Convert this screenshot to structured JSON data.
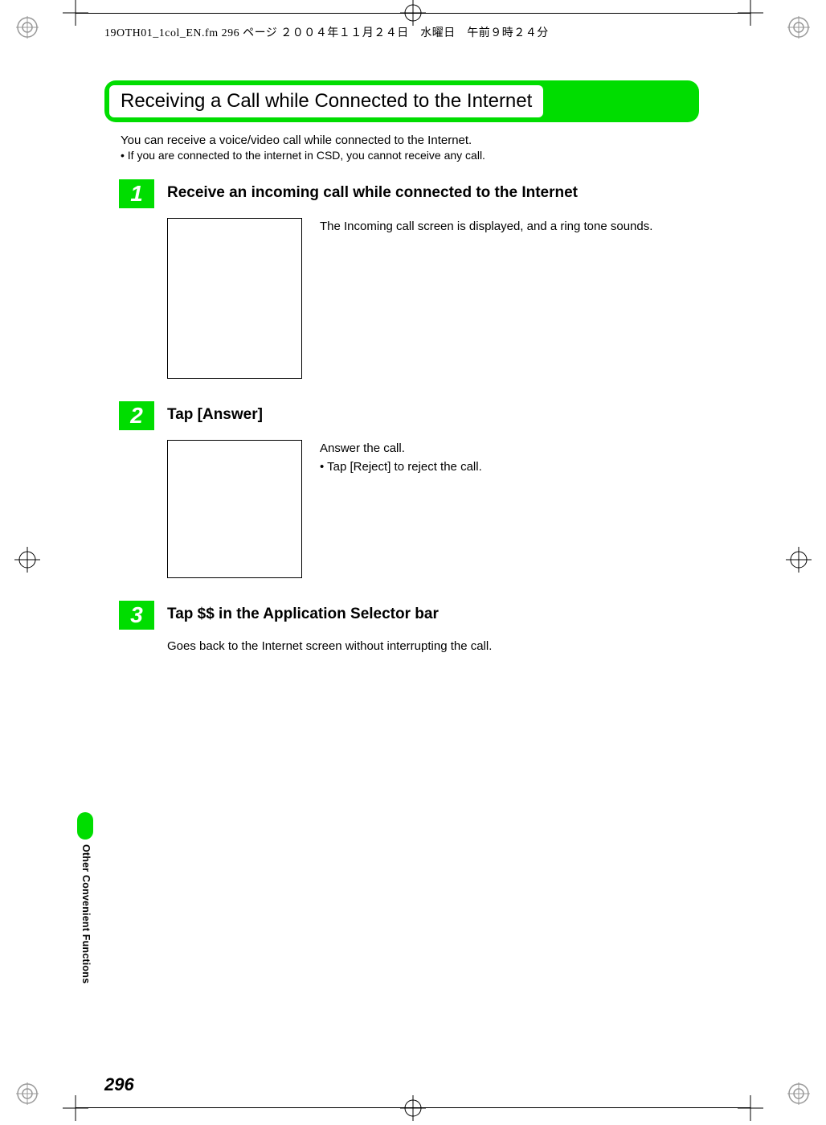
{
  "header": {
    "info_line": "19OTH01_1col_EN.fm  296 ページ  ２００４年１１月２４日　水曜日　午前９時２４分"
  },
  "title": "Receiving a Call while Connected to the Internet",
  "intro": {
    "text": "You can receive a voice/video call while connected to the Internet.",
    "bullet": "If you are connected to the internet in CSD, you cannot receive any call."
  },
  "steps": [
    {
      "num": "1",
      "title": "Receive an incoming call while connected to the Internet",
      "desc": "The Incoming call screen is displayed, and a ring tone sounds.",
      "has_screenshot": true,
      "screenshot_size": "large",
      "bullets": []
    },
    {
      "num": "2",
      "title": "Tap [Answer]",
      "desc": "Answer the call.",
      "has_screenshot": true,
      "screenshot_size": "small",
      "bullets": [
        "Tap [Reject] to reject the call."
      ]
    },
    {
      "num": "3",
      "title": "Tap $$ in the Application Selector bar",
      "desc": "Goes back to the Internet screen without interrupting the call.",
      "has_screenshot": false,
      "bullets": []
    }
  ],
  "side_label": "Other Convenient Functions",
  "page_number": "296"
}
